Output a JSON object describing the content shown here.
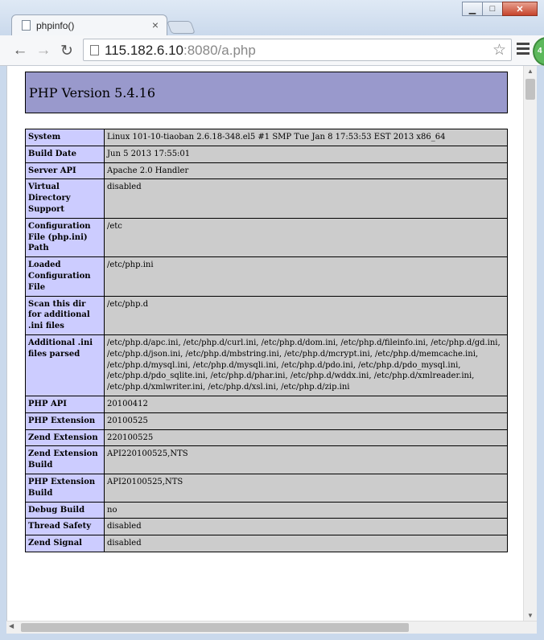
{
  "browser": {
    "tab_title": "phpinfo()",
    "tab_close": "×",
    "url_host": "115.182.6.10",
    "url_rest": ":8080/a.php",
    "back_glyph": "←",
    "forward_glyph": "→",
    "reload_glyph": "↻",
    "star_glyph": "☆",
    "window_buttons": {
      "minimize": "▁",
      "maximize": "□",
      "close": "✕"
    },
    "extension_badge": "4"
  },
  "page": {
    "title": "PHP Version 5.4.16",
    "rows": [
      {
        "name": "System",
        "value": "Linux 101-10-tiaoban 2.6.18-348.el5 #1 SMP Tue Jan 8 17:53:53 EST 2013 x86_64"
      },
      {
        "name": "Build Date",
        "value": "Jun 5 2013 17:55:01"
      },
      {
        "name": "Server API",
        "value": "Apache 2.0 Handler"
      },
      {
        "name": "Virtual Directory Support",
        "value": "disabled"
      },
      {
        "name": "Configuration File (php.ini) Path",
        "value": "/etc"
      },
      {
        "name": "Loaded Configuration File",
        "value": "/etc/php.ini"
      },
      {
        "name": "Scan this dir for additional .ini files",
        "value": "/etc/php.d"
      },
      {
        "name": "Additional .ini files parsed",
        "value": "/etc/php.d/apc.ini, /etc/php.d/curl.ini, /etc/php.d/dom.ini, /etc/php.d/fileinfo.ini, /etc/php.d/gd.ini, /etc/php.d/json.ini, /etc/php.d/mbstring.ini, /etc/php.d/mcrypt.ini, /etc/php.d/memcache.ini, /etc/php.d/mysql.ini, /etc/php.d/mysqli.ini, /etc/php.d/pdo.ini, /etc/php.d/pdo_mysql.ini, /etc/php.d/pdo_sqlite.ini, /etc/php.d/phar.ini, /etc/php.d/wddx.ini, /etc/php.d/xmlreader.ini, /etc/php.d/xmlwriter.ini, /etc/php.d/xsl.ini, /etc/php.d/zip.ini"
      },
      {
        "name": "PHP API",
        "value": "20100412"
      },
      {
        "name": "PHP Extension",
        "value": "20100525"
      },
      {
        "name": "Zend Extension",
        "value": "220100525"
      },
      {
        "name": "Zend Extension Build",
        "value": "API220100525,NTS"
      },
      {
        "name": "PHP Extension Build",
        "value": "API20100525,NTS"
      },
      {
        "name": "Debug Build",
        "value": "no"
      },
      {
        "name": "Thread Safety",
        "value": "disabled"
      },
      {
        "name": "Zend Signal",
        "value": "disabled"
      }
    ]
  }
}
